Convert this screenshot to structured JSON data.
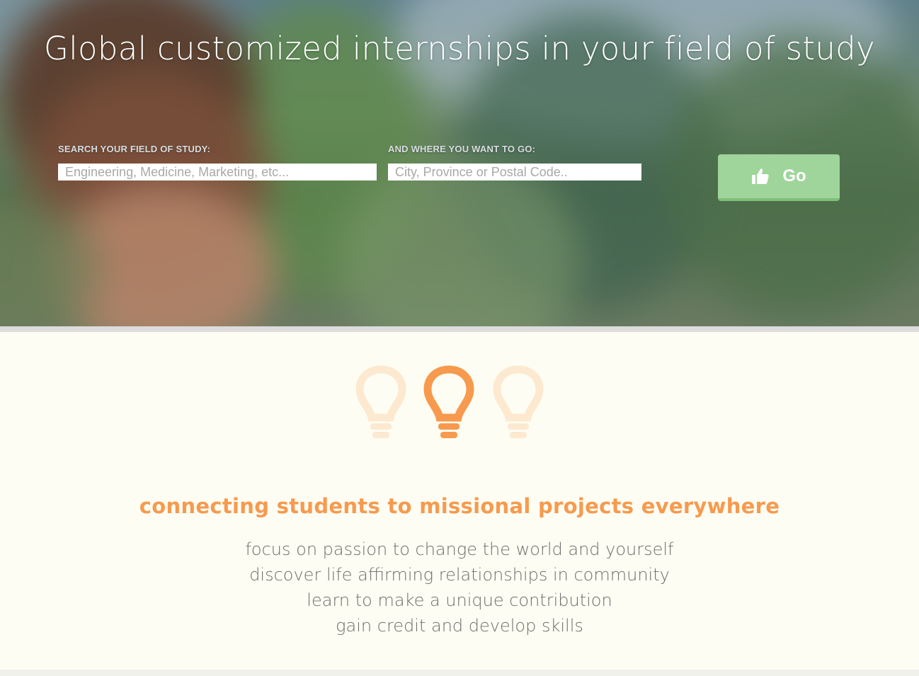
{
  "hero": {
    "title": "Global customized internships in your field of study"
  },
  "search": {
    "field_label": "SEARCH YOUR FIELD OF STUDY:",
    "field_placeholder": "Engineering, Medicine, Marketing, etc...",
    "location_label": "AND WHERE YOU WANT TO GO:",
    "location_placeholder": "City, Province or Postal Code..",
    "go_label": "Go",
    "go_icon": "thumbs-up-icon",
    "go_color": "#9fd49a"
  },
  "ideas": {
    "icons": [
      "lightbulb-icon",
      "lightbulb-icon",
      "lightbulb-icon"
    ],
    "active_index": 1,
    "active_color": "#f79a4e",
    "inactive_color": "#fde9cf"
  },
  "mission": {
    "tagline": "connecting students to missional projects everywhere",
    "points": [
      "focus on passion to change the world and yourself",
      "discover life affirming relationships in community",
      "learn to make a unique contribution",
      "gain credit and develop skills"
    ]
  }
}
